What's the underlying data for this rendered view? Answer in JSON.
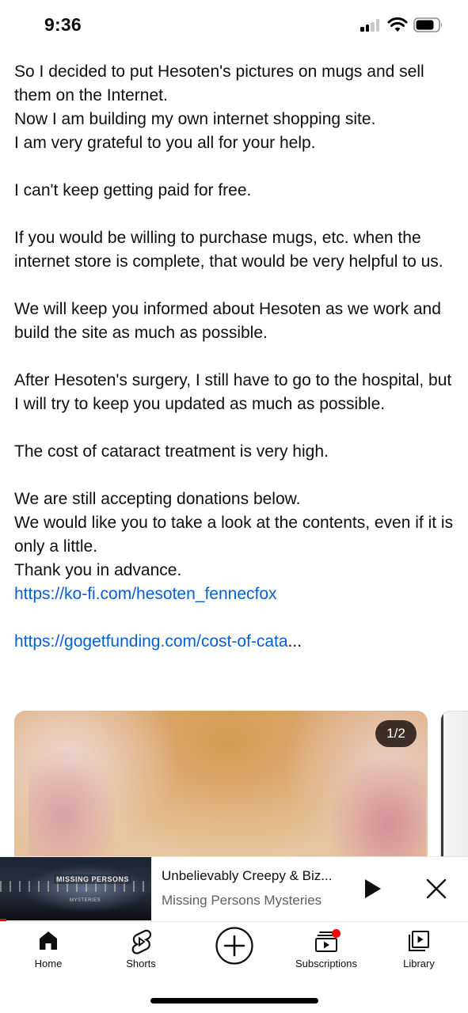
{
  "status_bar": {
    "time": "9:36"
  },
  "post": {
    "paragraphs": [
      [
        "So I decided to put Hesoten's pictures on mugs and sell them on the Internet.",
        "Now I am building my own internet shopping site.",
        "I am very grateful to you all for your help."
      ],
      [
        "I can't keep getting paid for free."
      ],
      [
        "If you would be willing to purchase mugs, etc. when the internet store is complete, that would be very helpful to us."
      ],
      [
        "We will keep you informed about Hesoten as we work and build the site as much as possible."
      ],
      [
        "After Hesoten's surgery, I still have to go to the hospital, but I will try to keep you updated as much as possible."
      ],
      [
        "The cost of cataract treatment is very high."
      ],
      [
        "We are still accepting donations below.",
        "We would like you to take a look at the contents, even if it is only a little.",
        "Thank you in advance."
      ]
    ],
    "link_kofi": "https://ko-fi.com/hesoten_fennecfox",
    "link_gogetfunding": "https://gogetfunding.com/cost-of-cata",
    "link_ellipsis": "...",
    "image_counter": "1/2"
  },
  "mini_player": {
    "thumbnail_text": "MISSING PERSONS",
    "thumbnail_subtext": "MYSTERIES",
    "title": "Unbelievably Creepy & Biz...",
    "channel": "Missing Persons Mysteries",
    "progress": 0.014
  },
  "bottom_nav": {
    "home": "Home",
    "shorts": "Shorts",
    "subscriptions": "Subscriptions",
    "library": "Library"
  },
  "colors": {
    "link": "#065fd4",
    "accent_red": "#ff0000",
    "text_primary": "#0f0f0f",
    "text_secondary": "#606060"
  }
}
